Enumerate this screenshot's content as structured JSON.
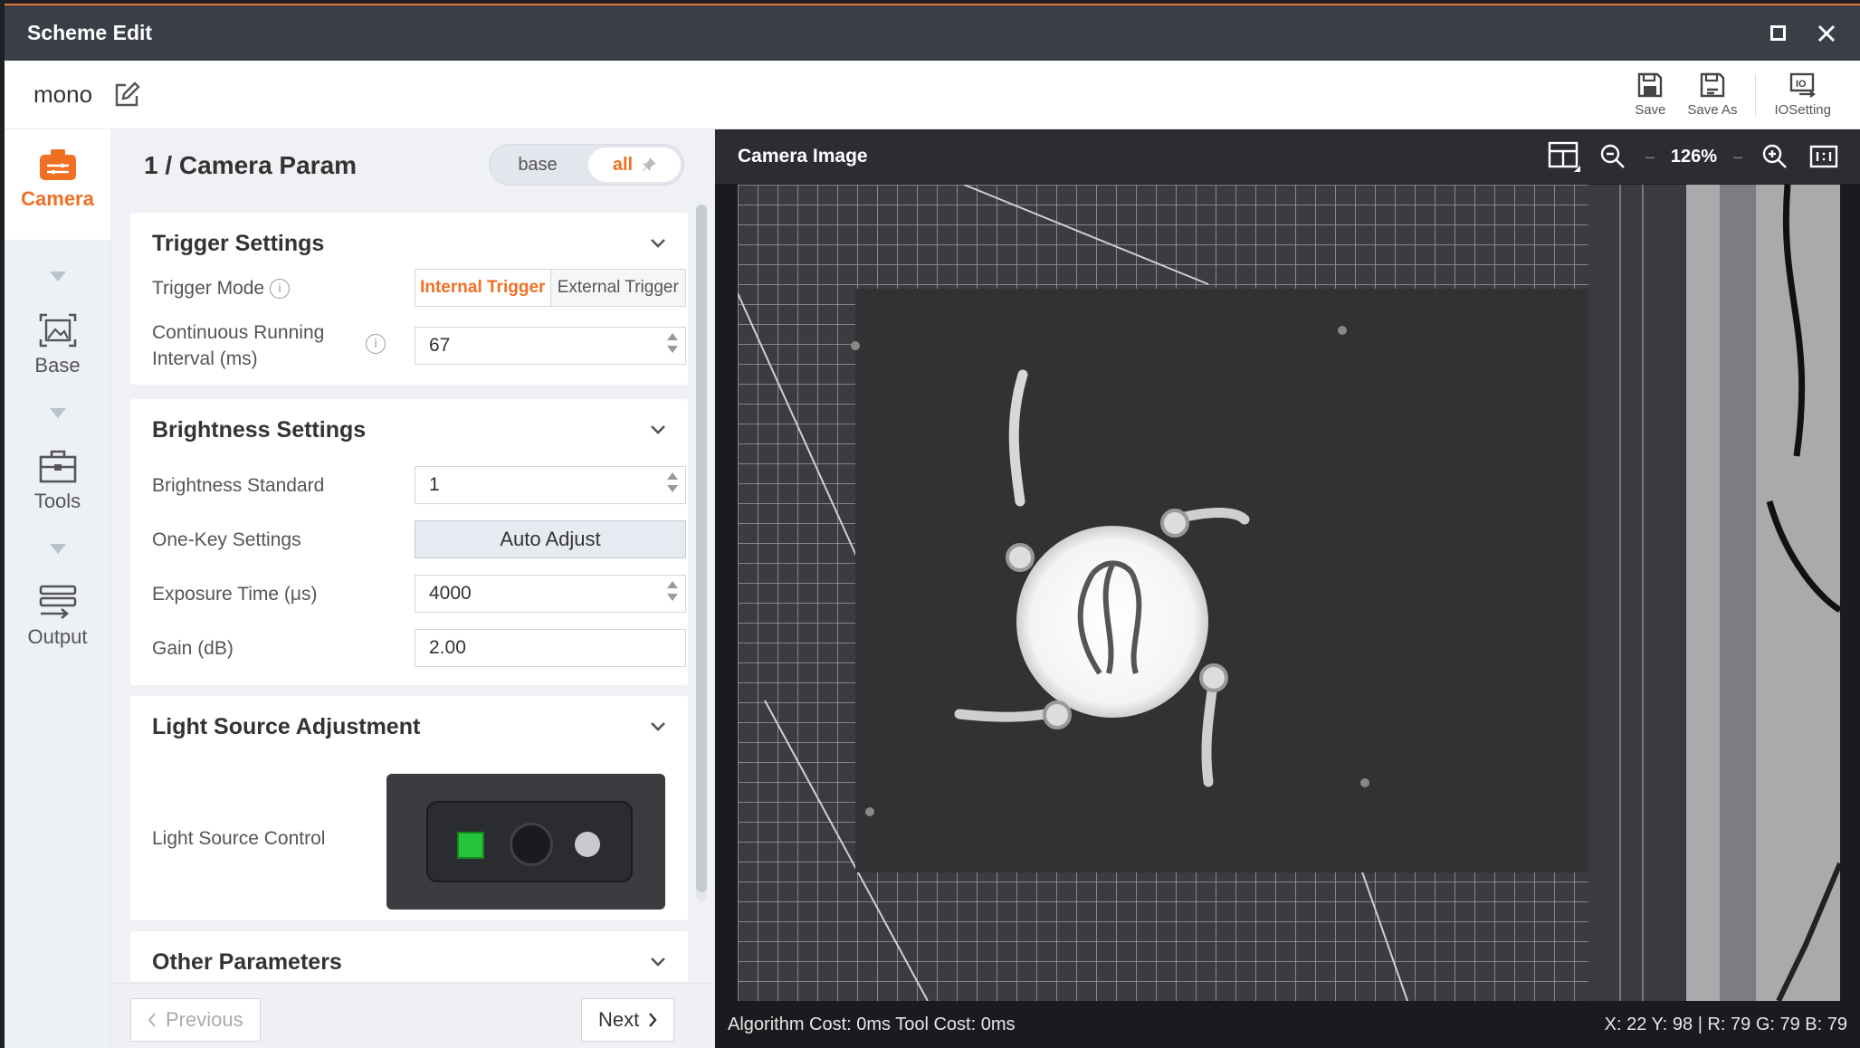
{
  "window": {
    "title": "Scheme Edit"
  },
  "toolbar": {
    "scheme_name": "mono",
    "save_label": "Save",
    "save_as_label": "Save As",
    "io_setting_label": "IOSetting"
  },
  "nav": [
    {
      "label": "Camera",
      "icon": "camera-icon",
      "active": true
    },
    {
      "label": "Base",
      "icon": "base-icon",
      "active": false
    },
    {
      "label": "Tools",
      "icon": "tools-icon",
      "active": false
    },
    {
      "label": "Output",
      "icon": "output-icon",
      "active": false
    }
  ],
  "panel": {
    "title": "1 / Camera Param",
    "view_toggle": {
      "base": "base",
      "all": "all",
      "selected": "all"
    },
    "trigger": {
      "title": "Trigger Settings",
      "mode_label": "Trigger Mode",
      "mode_options": [
        "Internal Trigger",
        "External Trigger"
      ],
      "mode_selected": "Internal Trigger",
      "interval_label_1": "Continuous Running",
      "interval_label_2": "Interval (ms)",
      "interval_value": "67"
    },
    "brightness": {
      "title": "Brightness Settings",
      "standard_label": "Brightness Standard",
      "standard_value": "1",
      "one_key_label": "One-Key Settings",
      "auto_adjust_label": "Auto Adjust",
      "exposure_label": "Exposure Time (μs)",
      "exposure_value": "4000",
      "gain_label": "Gain (dB)",
      "gain_value": "2.00"
    },
    "light": {
      "title": "Light Source Adjustment",
      "control_label": "Light Source Control"
    },
    "other": {
      "title": "Other Parameters"
    },
    "previous_label": "Previous",
    "next_label": "Next"
  },
  "view": {
    "title": "Camera Image",
    "zoom": "126%",
    "status_left": "Algorithm Cost: 0ms Tool Cost: 0ms",
    "status_right": "X: 22 Y: 98 | R: 79 G: 79 B: 79"
  },
  "colors": {
    "accent": "#f07023",
    "titlebar": "#3a3e47",
    "led_on": "#23c43a"
  }
}
